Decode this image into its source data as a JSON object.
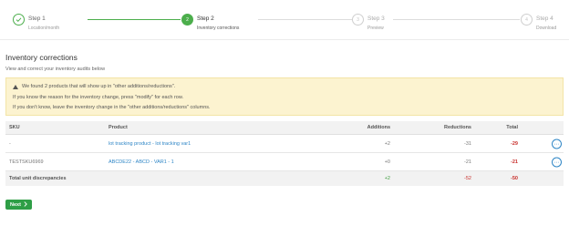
{
  "stepper": {
    "steps": [
      {
        "title": "Step 1",
        "sub": "Location/month",
        "state": "done",
        "icon": "check-icon"
      },
      {
        "title": "Step 2",
        "sub": "Inventory corrections",
        "state": "active",
        "num": "2"
      },
      {
        "title": "Step 3",
        "sub": "Preview",
        "state": "todo",
        "num": "3"
      },
      {
        "title": "Step 4",
        "sub": "Download",
        "state": "todo",
        "num": "4"
      }
    ]
  },
  "main": {
    "title": "Inventory corrections",
    "description": "View and correct your inventory audits below"
  },
  "alert": {
    "icon": "warning-icon",
    "line1": "We found 2 products that will show up in \"other additions/reductions\".",
    "line2": "If you know the reason for the inventory change, press \"modify\" for each row.",
    "line3": "If you don't know, leave the inventory change in the \"other additions/reductions\" columns."
  },
  "table": {
    "headers": {
      "sku": "SKU",
      "product": "Product",
      "additions": "Additions",
      "reductions": "Reductions",
      "total": "Total"
    },
    "rows": [
      {
        "sku": "-",
        "product": "lot tracking product - lot tracking var1",
        "additions": "+2",
        "reductions": "-31",
        "total": "-29",
        "action_icon": "dots-icon"
      },
      {
        "sku": "TESTSKU6969",
        "product": "ABCDE22 - ABCD - VAR1 - 1",
        "additions": "+0",
        "reductions": "-21",
        "total": "-21",
        "action_icon": "dots-icon"
      }
    ],
    "totals": {
      "label": "Total unit discrepancies",
      "additions": "+2",
      "reductions": "-52",
      "total": "-50"
    }
  },
  "next_button": {
    "label": "Next",
    "icon": "chevron-right-icon"
  },
  "colors": {
    "accent_green": "#4cae4c",
    "link_blue": "#2f86c6",
    "negative_red": "#c9302c",
    "alert_bg": "#fcf3d0"
  }
}
